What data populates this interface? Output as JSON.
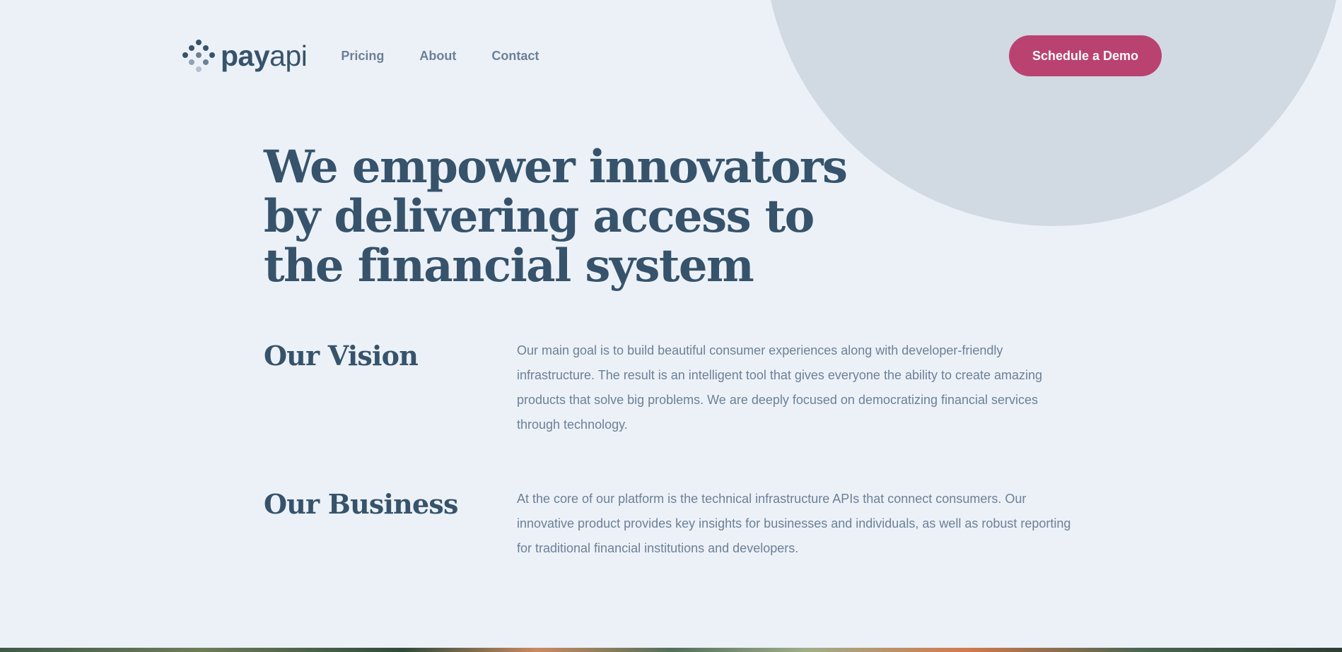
{
  "brand": {
    "name_bold": "pay",
    "name_light": "api"
  },
  "nav": {
    "items": [
      "Pricing",
      "About",
      "Contact"
    ]
  },
  "header": {
    "cta_label": "Schedule a Demo"
  },
  "hero": {
    "title": "We empower innovators by delivering access to the financial system"
  },
  "sections": [
    {
      "heading": "Our Vision",
      "body": "Our main goal is to build beautiful consumer experiences along with developer-friendly infrastructure. The result is an intelligent tool that gives everyone the ability to create amazing products that solve big problems. We are deeply focused on democratizing financial services through technology."
    },
    {
      "heading": "Our Business",
      "body": "At the core of our platform is the technical infrastructure APIs that connect consumers. Our innovative product provides key insights for businesses and individuals, as well as robust reporting for traditional financial institutions and developers."
    }
  ],
  "colors": {
    "background": "#ecf1f8",
    "circle": "#d1d9e3",
    "primary_text": "#36536b",
    "secondary_text": "#6c8096",
    "accent": "#ba4270"
  },
  "icons": {
    "logo": "payapi-dots-logo-icon"
  }
}
